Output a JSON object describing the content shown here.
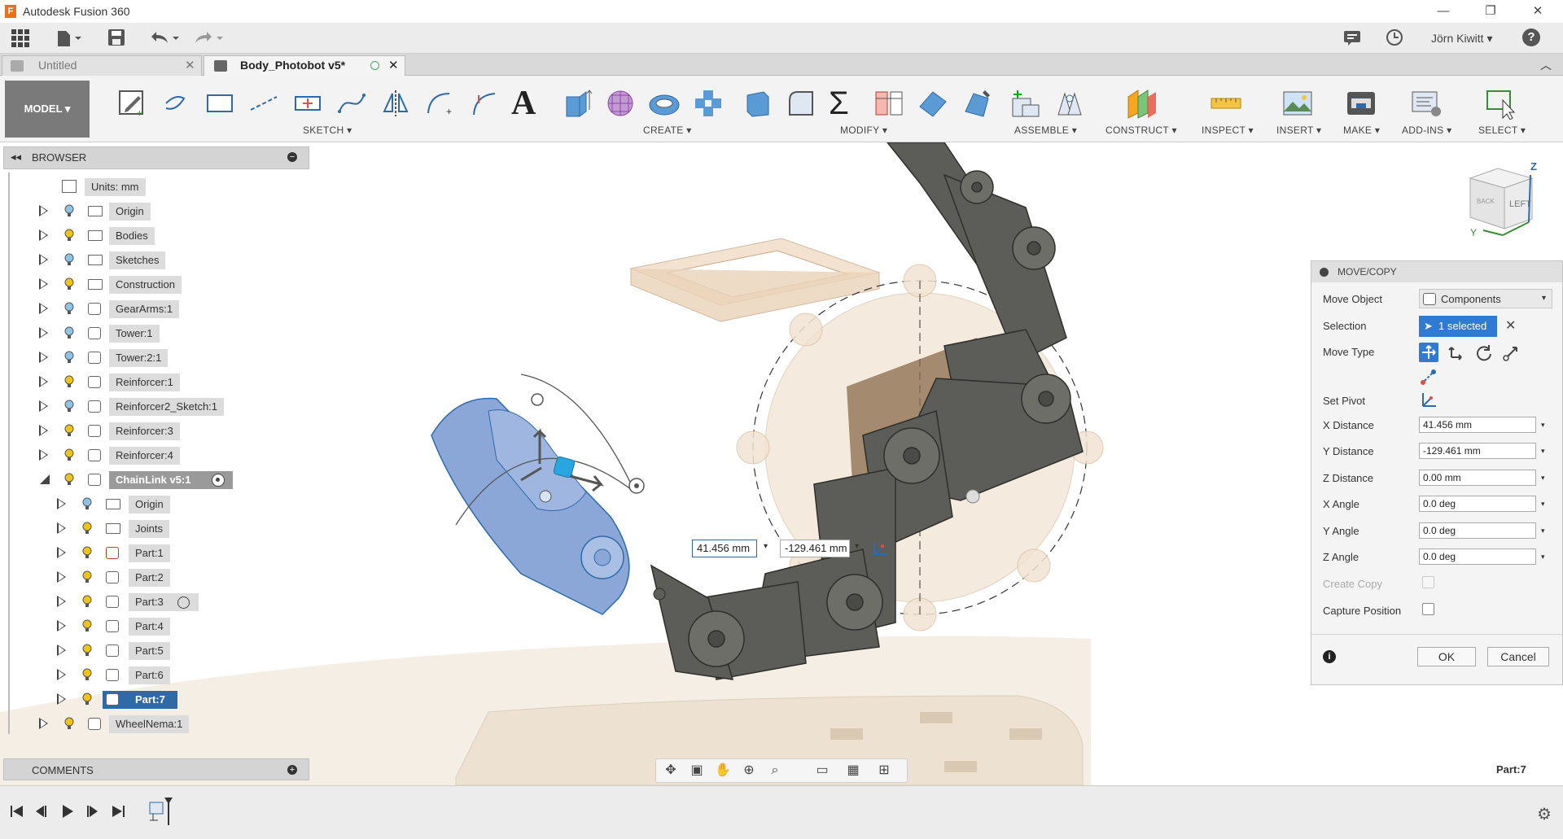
{
  "titlebar": {
    "app_icon": "F",
    "title": "Autodesk Fusion 360",
    "minimize": "—",
    "restore": "❐",
    "close": "✕"
  },
  "qat": {
    "user": "Jörn Kiwitt ▾",
    "help": "?"
  },
  "tabs": [
    {
      "label": "Untitled"
    },
    {
      "label": "Body_Photobot v5*"
    }
  ],
  "ribbon": {
    "model_label": "MODEL",
    "groups": [
      {
        "label": "SKETCH ▾"
      },
      {
        "label": "CREATE ▾"
      },
      {
        "label": "MODIFY ▾"
      },
      {
        "label": "ASSEMBLE ▾"
      },
      {
        "label": "CONSTRUCT ▾"
      },
      {
        "label": "INSPECT ▾"
      },
      {
        "label": "INSERT ▾"
      },
      {
        "label": "MAKE ▾"
      },
      {
        "label": "ADD-INS ▾"
      },
      {
        "label": "SELECT ▾"
      }
    ]
  },
  "browser": {
    "title": "BROWSER",
    "items": [
      {
        "label": "Units: mm"
      },
      {
        "label": "Origin"
      },
      {
        "label": "Bodies"
      },
      {
        "label": "Sketches"
      },
      {
        "label": "Construction"
      },
      {
        "label": "GearArms:1"
      },
      {
        "label": "Tower:1"
      },
      {
        "label": "Tower:2:1"
      },
      {
        "label": "Reinforcer:1"
      },
      {
        "label": "Reinforcer2_Sketch:1"
      },
      {
        "label": "Reinforcer:3"
      },
      {
        "label": "Reinforcer:4"
      },
      {
        "label": "ChainLink v5:1"
      },
      {
        "label": "Origin"
      },
      {
        "label": "Joints"
      },
      {
        "label": "Part:1"
      },
      {
        "label": "Part:2"
      },
      {
        "label": "Part:3"
      },
      {
        "label": "Part:4"
      },
      {
        "label": "Part:5"
      },
      {
        "label": "Part:6"
      },
      {
        "label": "Part:7"
      },
      {
        "label": "WheelNema:1"
      }
    ]
  },
  "comments": {
    "title": "COMMENTS"
  },
  "viewcube": {
    "face": "LEFT",
    "back": "BACK",
    "axis_z": "Z",
    "axis_y": "Y"
  },
  "viewport_inputs": {
    "x": "41.456 mm",
    "y": "-129.461 mm"
  },
  "status": {
    "selected_label": "Part:7"
  },
  "panel": {
    "title": "MOVE/COPY",
    "move_object_label": "Move Object",
    "move_object_value": "Components",
    "selection_label": "Selection",
    "selection_value": "1 selected",
    "move_type_label": "Move Type",
    "set_pivot_label": "Set Pivot",
    "x_distance_label": "X Distance",
    "x_distance": "41.456 mm",
    "y_distance_label": "Y Distance",
    "y_distance": "-129.461 mm",
    "z_distance_label": "Z Distance",
    "z_distance": "0.00 mm",
    "x_angle_label": "X Angle",
    "x_angle": "0.0 deg",
    "y_angle_label": "Y Angle",
    "y_angle": "0.0 deg",
    "z_angle_label": "Z Angle",
    "z_angle": "0.0 deg",
    "create_copy_label": "Create Copy",
    "capture_position_label": "Capture Position",
    "ok": "OK",
    "cancel": "Cancel"
  },
  "colors": {
    "accent": "#2f6aa8",
    "selection": "#8aa7d8",
    "bulb": "#f1c40f",
    "bulb_off": "#8ec5e6"
  }
}
